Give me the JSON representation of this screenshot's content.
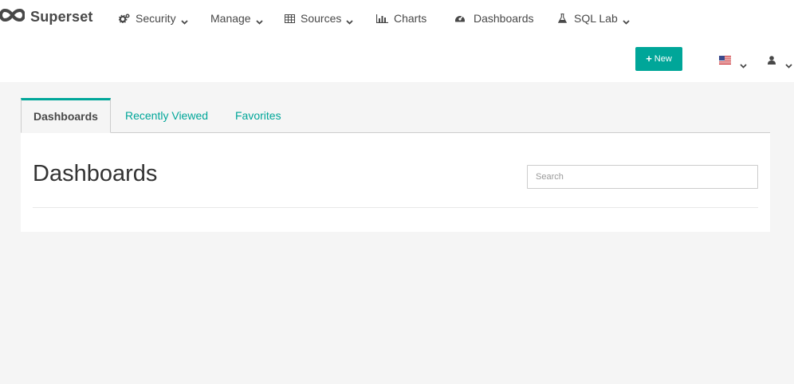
{
  "brand": {
    "name": "Superset",
    "logo_icon": "infinity-logo"
  },
  "nav": {
    "security": {
      "label": "Security",
      "icon": "cogs-icon"
    },
    "manage": {
      "label": "Manage"
    },
    "sources": {
      "label": "Sources",
      "icon": "table-icon"
    },
    "charts": {
      "label": "Charts",
      "icon": "bar-chart-icon"
    },
    "dashboards": {
      "label": "Dashboards",
      "icon": "dashboard-icon"
    },
    "sql_lab": {
      "label": "SQL Lab",
      "icon": "flask-icon"
    }
  },
  "actions": {
    "new_label": "New",
    "language_flag": "us-flag",
    "user_icon": "user-icon"
  },
  "tabs": [
    {
      "label": "Dashboards",
      "active": true
    },
    {
      "label": "Recently Viewed",
      "active": false
    },
    {
      "label": "Favorites",
      "active": false
    }
  ],
  "main": {
    "title": "Dashboards",
    "search_placeholder": "Search"
  },
  "colors": {
    "accent": "#00a699",
    "text": "#484848",
    "background": "#f5f5f5"
  }
}
